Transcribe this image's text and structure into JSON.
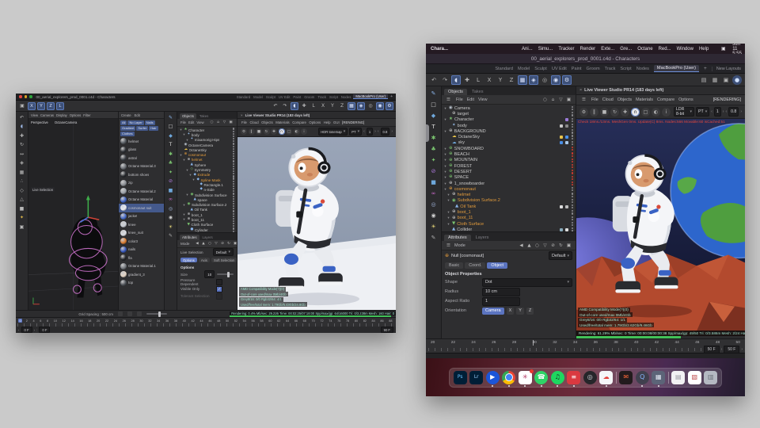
{
  "macos": {
    "app": "Chara...",
    "menus": [
      "Ani...",
      "Simu...",
      "Tracker",
      "Render",
      "Exte...",
      "Gre...",
      "Octane",
      "Red...",
      "Window",
      "Help"
    ],
    "clock": "Sat Jun 11 5:55 PM"
  },
  "c4d": {
    "title": "00_aerial_explorers_prod_0001.c4d - Characters",
    "layouts": [
      "Standard",
      "Model",
      "Sculpt",
      "UV Edit",
      "Paint",
      "Groom",
      "Track",
      "Script",
      "Nodes"
    ],
    "active_layout": "MacBookPro (User)",
    "plus": "+",
    "new_layouts": "New Layouts",
    "toolbar_icons": [
      {
        "n": "undo-icon",
        "g": "↶"
      },
      {
        "n": "redo-icon",
        "g": "↷"
      },
      {
        "n": "live-selection-tool-icon",
        "g": "◖",
        "a": 1
      },
      {
        "n": "move-tool-icon",
        "g": "✚"
      },
      {
        "n": "workplane-lock-icon",
        "g": "L"
      },
      {
        "n": "x-axis-lock-icon",
        "g": "X"
      },
      {
        "n": "y-axis-lock-icon",
        "g": "Y"
      },
      {
        "n": "z-axis-lock-icon",
        "g": "Z"
      },
      {
        "n": "grid-snap-icon",
        "g": "▦",
        "a": 1
      },
      {
        "n": "magnet-snap-icon",
        "g": "◈",
        "a": 1
      },
      {
        "n": "render-view-icon",
        "g": "◎"
      },
      {
        "n": "picture-viewer-icon",
        "g": "◉",
        "a": 1
      },
      {
        "n": "render-settings-icon",
        "g": "⚙",
        "a": 1
      }
    ],
    "side_icons": [
      {
        "n": "spline-pen-icon",
        "g": "✎",
        "c": "#8ab4e8"
      },
      {
        "n": "cube-icon",
        "g": "□",
        "c": "#cfcfcf"
      },
      {
        "n": "platonic-icon",
        "g": "◆",
        "c": "#6fa8dc"
      },
      {
        "n": "text-icon",
        "g": "T",
        "c": "#e0e0e0"
      },
      {
        "n": "generators-icon",
        "g": "✱",
        "c": "#7ac36f"
      },
      {
        "n": "scene-icon",
        "g": "♣",
        "c": "#7ac36f"
      },
      {
        "n": "field-icon",
        "g": "✦",
        "c": "#7ac36f"
      },
      {
        "n": "deformer-icon",
        "g": "⊘",
        "c": "#b07ae0"
      },
      {
        "n": "volume-icon",
        "g": "■",
        "c": "#6fa8dc"
      },
      {
        "n": "mograph-icon",
        "g": "∞",
        "c": "#d06ad0"
      },
      {
        "n": "simulation-icon",
        "g": "◎",
        "c": "#9fb3d8"
      },
      {
        "n": "camera-icon",
        "g": "◉",
        "c": "#cfcfcf"
      },
      {
        "n": "light-icon",
        "g": "☀",
        "c": "#e8d87a"
      },
      {
        "n": "edit-pencil-icon",
        "g": "✎",
        "c": "#aaaaaa"
      }
    ],
    "obj_menu_icons": [
      {
        "n": "search-icon",
        "g": "○"
      },
      {
        "n": "home-icon",
        "g": "⌂"
      },
      {
        "n": "filter-icon",
        "g": "▽"
      },
      {
        "n": "panel-icon",
        "g": "▣"
      }
    ],
    "attr_icons": [
      {
        "n": "back-icon",
        "g": "◀"
      },
      {
        "n": "up-icon",
        "g": "▲"
      },
      {
        "n": "search-icon",
        "g": "○"
      },
      {
        "n": "filter-icon",
        "g": "▽"
      },
      {
        "n": "lock-icon",
        "g": "⊘"
      },
      {
        "n": "refresh-icon",
        "g": "↻"
      },
      {
        "n": "panel-icon",
        "g": "▣"
      }
    ],
    "viewer_icons": [
      {
        "n": "viewer-settings-icon",
        "g": "⚙"
      },
      {
        "n": "pause-icon",
        "g": "‖"
      },
      {
        "n": "stop-icon",
        "g": "■"
      },
      {
        "n": "restart-icon",
        "g": "↻"
      },
      {
        "n": "focus-pick-icon",
        "g": "✚"
      },
      {
        "n": "camera-lock-icon",
        "g": "∩",
        "a": 1
      },
      {
        "n": "region-icon",
        "g": "□"
      },
      {
        "n": "day-night-icon",
        "g": "◐"
      },
      {
        "n": "info-icon",
        "g": "i"
      }
    ]
  },
  "right": {
    "objects": {
      "tabs": [
        "Objects",
        "Takes"
      ],
      "menu": [
        "File",
        "Edit",
        "View"
      ],
      "tree": [
        {
          "l": "Camera",
          "i": "cam",
          "ind": 0,
          "k": 1
        },
        {
          "l": "target",
          "i": "nul",
          "ind": 1
        },
        {
          "l": "Character",
          "i": "chr",
          "ind": 0,
          "k": 1,
          "t": [
            "#9b7ad8"
          ]
        },
        {
          "l": "body",
          "i": "jnt",
          "ind": 1,
          "t": [
            "#c8c8c8",
            "#888888"
          ]
        },
        {
          "l": "BACKGROUND",
          "i": "nul",
          "ind": 0,
          "k": 1
        },
        {
          "l": "OctaneSky",
          "i": "sko",
          "ind": 1,
          "t": [
            "#e8c34a",
            "#4a90e8"
          ]
        },
        {
          "l": "sky",
          "i": "sky",
          "ind": 1,
          "t": [
            "#4a90e8",
            "#a8c8e8"
          ]
        },
        {
          "l": "SNOWBOARD",
          "i": "nug",
          "ind": 0,
          "k": 1,
          "d": "r"
        },
        {
          "l": "BEACH",
          "i": "nug",
          "ind": 0,
          "k": 1,
          "d": "r"
        },
        {
          "l": "MOUNTAIN",
          "i": "nug",
          "ind": 0,
          "k": 1,
          "d": "r"
        },
        {
          "l": "FOREST",
          "i": "nug",
          "ind": 0,
          "k": 1,
          "d": "r"
        },
        {
          "l": "DESERT",
          "i": "nug",
          "ind": 0,
          "k": 1,
          "d": "r"
        },
        {
          "l": "SPACE",
          "i": "nug",
          "ind": 0,
          "k": 1,
          "d": "r"
        },
        {
          "l": "1_snowboarder",
          "i": "nul",
          "ind": 0,
          "k": 1,
          "d": "r"
        },
        {
          "l": "cosmonaut",
          "i": "nuo",
          "c": "o",
          "ind": 0,
          "k": 1
        },
        {
          "l": "helmet",
          "i": "nul",
          "c": "o",
          "ind": 1,
          "k": 1
        },
        {
          "l": "Subdivision Surface.2",
          "i": "sds",
          "c": "o",
          "ind": 1,
          "k": 1
        },
        {
          "l": "Oil Tank",
          "i": "geo",
          "c": "o",
          "ind": 2,
          "t": [
            "#dddddd",
            "#bbbbbb"
          ]
        },
        {
          "l": "boot_1",
          "i": "nul",
          "c": "o",
          "ind": 1,
          "k": 1
        },
        {
          "l": "boot_11",
          "i": "nul",
          "c": "o",
          "ind": 1,
          "k": 1
        },
        {
          "l": "Cloth Surface",
          "i": "clo",
          "c": "o",
          "ind": 1,
          "k": 1
        },
        {
          "l": "Collider",
          "i": "geo",
          "ind": 1,
          "t": [
            "#88aabb",
            "#dddddd"
          ]
        }
      ]
    },
    "attributes": {
      "tabs": [
        "Attributes",
        "Layers"
      ],
      "mode": "Mode",
      "object": "Null [cosmonaut]",
      "preset": "Default",
      "subtabs": [
        "Basic",
        "Coord.",
        "Object"
      ],
      "section": "Object Properties",
      "shape_label": "Shape",
      "shape_value": "Dot",
      "radius_label": "Radius",
      "radius_value": "10 cm",
      "aspect_label": "Aspect Ratio",
      "aspect_value": "1",
      "orient_label": "Orientation",
      "orient_value": "Camera",
      "axes": [
        "X",
        "Y",
        "Z"
      ]
    },
    "viewer": {
      "close": "×",
      "title": "Live Viewer Studio PR14 (183 days left)",
      "menus": [
        "File",
        "Cloud",
        "Objects",
        "Materials",
        "Compare",
        "Options"
      ],
      "badge": "[RENDERING]",
      "tonemap": "LDR 8-bit",
      "kernel": "PT",
      "samples": "1",
      "gamma": "0.8",
      "perf": "Check 18ms./13ms. MeshGen 0ms. Update(C) 8ms. Nodes:566 Movable:60 isCached:51",
      "overlay": [
        "AMD Compatibility Mode(?)(0)",
        "Out-of-core used/max 0Mb/4Gb",
        "Grey8/16: 0/0    Rgb32/64: 1/1",
        "Used/free/total mem: 1.79Gb/2.62Gb/9.46Gb"
      ],
      "status": "Rendering: 61.29%   Mb/sec: 0   Time: 00:00:08/00:00:38   Spp/max/gp: 49/50   Tri: 0/3.586m   Mesh: 2/24   Hair: 0",
      "progress": "62"
    },
    "timeline": {
      "nums": [
        20,
        22,
        24,
        26,
        28,
        30,
        32,
        34,
        36,
        38,
        40,
        42,
        44,
        46,
        48,
        50
      ],
      "current": "30"
    },
    "fields": {
      "a": "50 F",
      "b": "50 F"
    },
    "dock": [
      {
        "n": "photoshop-dock-icon",
        "label": "Ps",
        "bg": "#001e36",
        "fg": "#6fc4ff"
      },
      {
        "n": "lightroom-dock-icon",
        "label": "Lr",
        "bg": "#001e36",
        "fg": "#9bd1ff"
      },
      {
        "n": "player-dock-icon",
        "label": "▶",
        "bg": "#1c55d8",
        "fg": "#ffffff",
        "r": "50%",
        "run": 1
      },
      {
        "n": "chrome-dock-icon",
        "chrome": true,
        "run": 1
      },
      {
        "n": "slack-dock-icon",
        "label": "✳",
        "bg": "#ffffff",
        "fg": "#b0305c",
        "badge": 1,
        "run": 1
      },
      {
        "n": "whatsapp-dock-icon",
        "label": "☎",
        "bg": "#2fd366",
        "fg": "#ffffff",
        "r": "50%",
        "run": 1
      },
      {
        "n": "spotify-dock-icon",
        "label": "♫",
        "bg": "#1ed760",
        "fg": "#15301e",
        "r": "50%",
        "run": 1
      },
      {
        "n": "expressvpn-dock-icon",
        "label": "≡",
        "bg": "#da3940",
        "fg": "#ffffff",
        "run": 1
      },
      {
        "n": "octane-dock-icon",
        "label": "◎",
        "bg": "#26262a",
        "fg": "#cfd4da",
        "r": "50%"
      },
      {
        "n": "sync-cloud-dock-icon",
        "label": "☁",
        "bg": "#f5f6f8",
        "fg": "#e2403a",
        "run": 1
      },
      {
        "sep": true
      },
      {
        "n": "mail-dock-icon",
        "label": "✉",
        "bg": "#221b1d",
        "fg": "#ff6a3a"
      },
      {
        "n": "quicktime-dock-icon",
        "label": "Q",
        "bg": "#40404e",
        "fg": "#86b8ff",
        "r": "50%",
        "run": 1
      },
      {
        "n": "screens-dock-icon",
        "label": "▦",
        "bg": "#5c6478",
        "fg": "#e4e9f4",
        "run": 1
      },
      {
        "sep": true
      },
      {
        "n": "document-dock-icon",
        "label": "▤",
        "bg": "#f2f2f4",
        "fg": "#9a9aa2"
      },
      {
        "n": "downloads-dock-icon",
        "label": "▧",
        "bg": "#ffffff",
        "fg": "#c05050"
      },
      {
        "n": "trash-dock-icon",
        "label": "▥",
        "bg": "#b4b9c2",
        "fg": "#6a6f78",
        "r": "4px"
      }
    ]
  },
  "left": {
    "axis_buttons": [
      "X",
      "Y",
      "Z",
      "L"
    ],
    "side_icons": [
      {
        "n": "undo-icon",
        "g": "↶",
        "c": "#b8b8b8"
      },
      {
        "n": "live-selection-icon",
        "g": "◖",
        "c": "#9ab4e0"
      },
      {
        "n": "move-icon",
        "g": "✚",
        "c": "#b8b8b8"
      },
      {
        "n": "rotate-icon",
        "g": "↻",
        "c": "#b8b8b8"
      },
      {
        "n": "scale-icon",
        "g": "↔",
        "c": "#b8b8b8"
      },
      {
        "n": "snap-icon",
        "g": "◈",
        "c": "#b8b8b8"
      },
      {
        "n": "grid-icon",
        "g": "▦",
        "c": "#b8b8b8"
      },
      {
        "n": "points-mode-icon",
        "g": "∴",
        "c": "#b8b8b8"
      },
      {
        "n": "edges-mode-icon",
        "g": "◇",
        "c": "#b8b8b8"
      },
      {
        "n": "polygons-mode-icon",
        "g": "△",
        "c": "#b8b8b8"
      },
      {
        "n": "model-mode-icon",
        "g": "■",
        "c": "#b8b8b8"
      },
      {
        "n": "axis-mode-icon",
        "g": "✦",
        "c": "#e0b84a"
      },
      {
        "n": "texture-mode-icon",
        "g": "▣",
        "c": "#b8b8b8"
      }
    ],
    "viewport": {
      "menus": [
        "View",
        "Cameras",
        "Display",
        "Options",
        "Filter"
      ],
      "cam": "Perspective",
      "camera_name": "OctaneCamera",
      "tool_chip": "Live Selection"
    },
    "materials_menu": [
      "Create",
      "Edit"
    ],
    "mat_chips": [
      "All",
      "No Layer",
      "Nails",
      "Gradient",
      "Surfer",
      "Hair",
      "Clothes"
    ],
    "materials": [
      {
        "l": "helmet",
        "c1": "#555a60"
      },
      {
        "l": "glass",
        "c1": "#2b2e33"
      },
      {
        "l": "astral",
        "c1": "#3a3e44"
      },
      {
        "l": "Octane Material.3",
        "c1": "#6a6e74"
      },
      {
        "l": "bottom shoes",
        "c1": "#26282c"
      },
      {
        "l": "zip",
        "c1": "#8a8e94"
      },
      {
        "l": "Octane Material.2",
        "c1": "#9aa0a8"
      },
      {
        "l": "Octane Material",
        "c1": "#3a5fc0"
      },
      {
        "l": "cosmonaut suit",
        "c1": "#e8eaee",
        "s": 1
      },
      {
        "l": "jacket",
        "c1": "#4468c8"
      },
      {
        "l": "knee",
        "c1": "#c8ccd4"
      },
      {
        "l": "knee_suit",
        "c1": "#dadee4"
      },
      {
        "l": "color3",
        "c1": "#d97a2e"
      },
      {
        "l": "nails",
        "c1": "#3355bb"
      },
      {
        "l": "fla",
        "c1": "#222428"
      },
      {
        "l": "Octane Material.1",
        "c1": "#74787e"
      },
      {
        "l": "gradient_3",
        "c1": "#e4d4c4"
      },
      {
        "l": "top",
        "c1": "#4a4e54"
      }
    ],
    "objects": {
      "tabs": [
        "Objects",
        "Takes"
      ],
      "menu": [
        "File",
        "Edit",
        "View"
      ],
      "tree": [
        {
          "l": "Character",
          "i": "chr",
          "ind": 0,
          "k": 1
        },
        {
          "l": "body",
          "i": "jnt",
          "ind": 1,
          "k": 1
        },
        {
          "l": "mixamorig:Hips",
          "i": "jnt",
          "ind": 2,
          "k": 1
        },
        {
          "l": "OctaneCamera",
          "i": "cam",
          "ind": 0
        },
        {
          "l": "OctaneSky",
          "i": "sko",
          "ind": 0
        },
        {
          "l": "cosmonaut",
          "i": "nuo",
          "c": "o",
          "ind": 0,
          "k": 1
        },
        {
          "l": "helmet",
          "i": "nul",
          "c": "o",
          "ind": 1,
          "k": 1
        },
        {
          "l": "Sphere",
          "i": "geo",
          "ind": 2
        },
        {
          "l": "Symmetry",
          "i": "sym",
          "ind": 2,
          "k": 1
        },
        {
          "l": "Extrude",
          "i": "spl",
          "c": "o",
          "ind": 3,
          "k": 1
        },
        {
          "l": "Spline Mask",
          "i": "spl",
          "c": "o",
          "ind": 4,
          "k": 1
        },
        {
          "l": "Rectangle.1",
          "i": "spl",
          "ind": 5
        },
        {
          "l": "n-Side",
          "i": "spl",
          "ind": 5
        },
        {
          "l": "Subdivision Surface",
          "i": "sds",
          "ind": 2,
          "k": 1
        },
        {
          "l": "space",
          "i": "geo",
          "ind": 3
        },
        {
          "l": "Subdivision Surface.2",
          "i": "sds",
          "ind": 1,
          "k": 1
        },
        {
          "l": "Oil Tank",
          "i": "geo",
          "ind": 2
        },
        {
          "l": "boot_1",
          "i": "nul",
          "ind": 1,
          "k": 1
        },
        {
          "l": "boot_11",
          "i": "nul",
          "ind": 1,
          "k": 1
        },
        {
          "l": "Cloth Surface",
          "i": "clo",
          "ind": 1
        },
        {
          "l": "Cylinder",
          "i": "cyl",
          "ind": 2
        }
      ]
    },
    "attributes": {
      "tabs": [
        "Attributes",
        "Layers"
      ],
      "mode": "Mode",
      "tool": "Live Selection",
      "preset": "Default",
      "subtabs": [
        "Options",
        "Axis",
        "Soft Selection"
      ],
      "section": "Options",
      "size_label": "Size",
      "size_value": "10",
      "checks": [
        {
          "label": "Pressure Dependent",
          "on": false
        },
        {
          "label": "Visible Only",
          "on": true
        },
        {
          "label": "Tolerant Selection",
          "on": false,
          "dim": true
        }
      ]
    },
    "viewer": {
      "close": "×",
      "title": "Live Viewer Studio PR14 (183 days left)",
      "menus": [
        "File",
        "Cloud",
        "Objects",
        "Materials",
        "Compare",
        "Options",
        "Help",
        "GUI"
      ],
      "badge": "[RENDERING]",
      "tonemap": "HDR tonemap",
      "kernel": "PT",
      "samples": "1",
      "gamma": "0.8",
      "overlay": [
        "AMD Compatibility Mode(?)(0)",
        "Out-of-core used/max 0Mb/4Gb",
        "Grey8/16: 0/0   Rgb32/64: 4/1",
        "Used/free/total mem: 1.79Gb/5.43Gb/24.8Gb"
      ],
      "status": "Rendering: 0.4%   Mb/sec: 29.226   Time: 00:02:25/07:18:00   Spp/max/gp: 64/16000   Tri: 0/3.238m   Mesh: 160   Hair: 0",
      "progress": "97"
    },
    "grid": "Grid Spacing : 500 cm",
    "timeline": {
      "nums": [
        0,
        2,
        4,
        6,
        8,
        10,
        12,
        14,
        16,
        18,
        20,
        22,
        24,
        26,
        28,
        30,
        32,
        34,
        36,
        38,
        40,
        42,
        44,
        46,
        48,
        50,
        52,
        54,
        56,
        58,
        60,
        62,
        64,
        66,
        68,
        70,
        72,
        74,
        76,
        78,
        80,
        82,
        84,
        86,
        88
      ],
      "current": "0"
    },
    "fields": {
      "a": "0 F",
      "b": "0 F",
      "end": "90 F"
    }
  }
}
